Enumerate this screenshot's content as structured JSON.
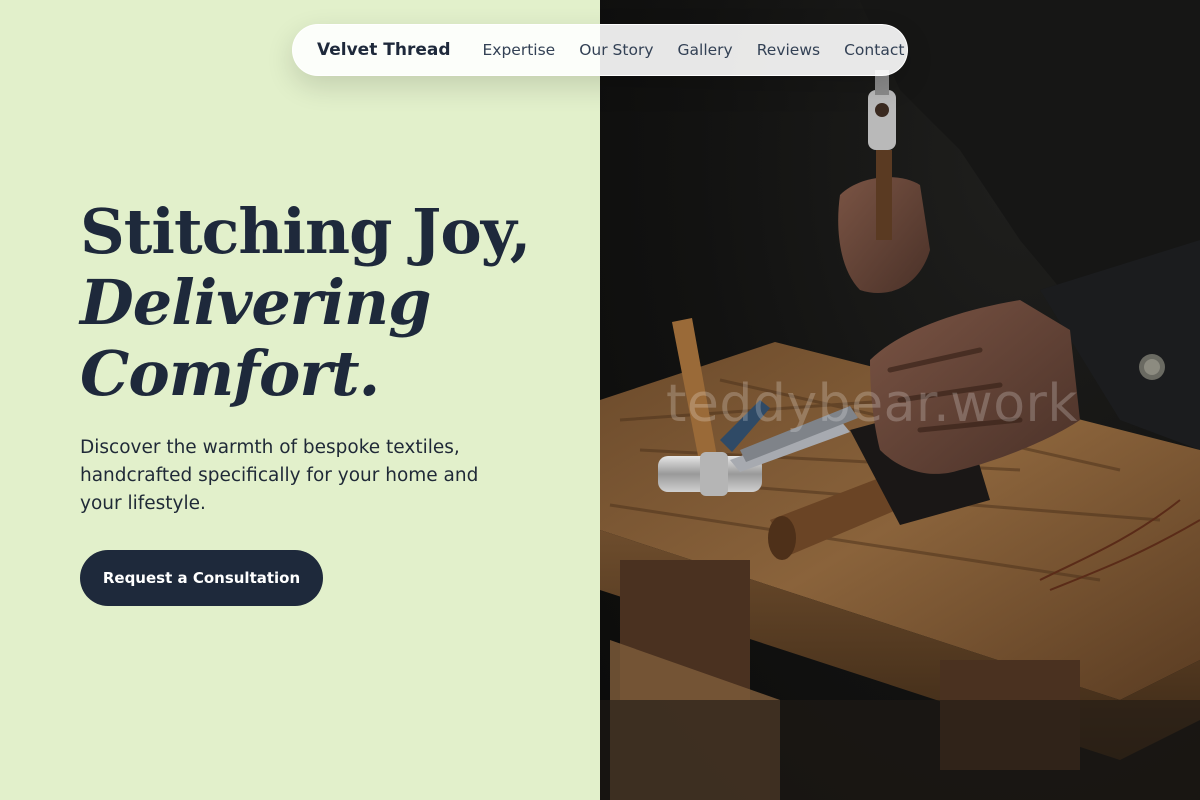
{
  "nav": {
    "brand": "Velvet Thread",
    "links": [
      "Expertise",
      "Our Story",
      "Gallery",
      "Reviews",
      "Contact"
    ]
  },
  "hero": {
    "title_line1": "Stitching Joy,",
    "title_line2": "Delivering",
    "title_line3": "Comfort.",
    "description": "Discover the warmth of bespoke textiles, handcrafted specifically for your home and your lifestyle.",
    "cta_label": "Request a Consultation"
  },
  "photo": {
    "watermark": "teddybear.work"
  },
  "colors": {
    "background": "#e2f0cb",
    "primary": "#1e293b",
    "nav_background": "#ffffff"
  }
}
